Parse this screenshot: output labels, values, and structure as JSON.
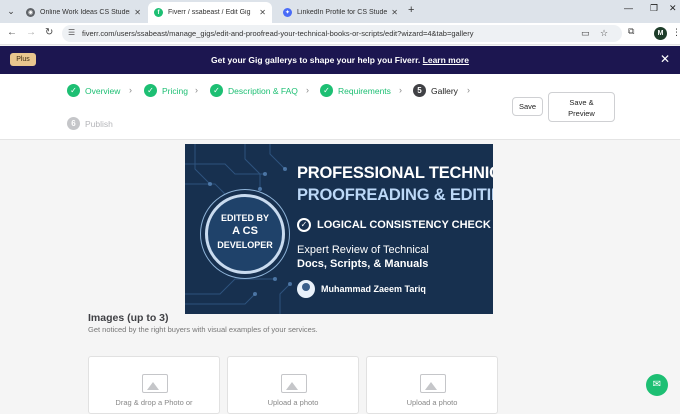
{
  "tabs": [
    {
      "label": "Online Work Ideas CS Student",
      "icon": "chrome-icon",
      "color": "#5f6368"
    },
    {
      "label": "Fiverr / ssabeast / Edit Gig",
      "icon": "fiverr-icon",
      "color": "#1dbf73"
    },
    {
      "label": "LinkedIn Profile for CS Student",
      "icon": "sparkle-icon",
      "color": "#4a6cf7"
    }
  ],
  "address": {
    "url": "fiverr.com/users/ssabeast/manage_gigs/edit-and-proofread-your-technical-books-or-scripts/edit?wizard=4&tab=gallery"
  },
  "account": {
    "initial": "M"
  },
  "banner": {
    "plus": "Plus",
    "text": "Get your Gig gallerys to shape your help you Fiverr. ",
    "link": "Learn more",
    "bg_color": "#1c1650"
  },
  "wizard": {
    "steps": [
      {
        "num": "1",
        "label": "Overview",
        "state": "done"
      },
      {
        "num": "2",
        "label": "Pricing",
        "state": "done"
      },
      {
        "num": "3",
        "label": "Description & FAQ",
        "state": "done"
      },
      {
        "num": "4",
        "label": "Requirements",
        "state": "done"
      },
      {
        "num": "5",
        "label": "Gallery",
        "state": "current"
      },
      {
        "num": "6",
        "label": "Publish",
        "state": "todo"
      }
    ],
    "save_label": "Save",
    "preview_line1": "Save &",
    "preview_line2": "Preview",
    "accent": "#1dbf73"
  },
  "gig_image": {
    "badge": [
      "EDITED BY",
      "A CS",
      "DEVELOPER"
    ],
    "title1": "PROFESSIONAL TECHNICAL",
    "title2": "PROOFREADING & EDITING",
    "check": "LOGICAL CONSISTENCY CHECK",
    "expert1": "Expert Review of Technical",
    "expert2": "Docs, Scripts, & Manuals",
    "author": "Muhammad Zaeem Tariq"
  },
  "images_section": {
    "title": "Images (up to 3)",
    "subtitle": "Get noticed by the right buyers with visual examples of your services.",
    "slots": [
      "Drag & drop a Photo or",
      "Upload a photo",
      "Upload a photo"
    ]
  }
}
